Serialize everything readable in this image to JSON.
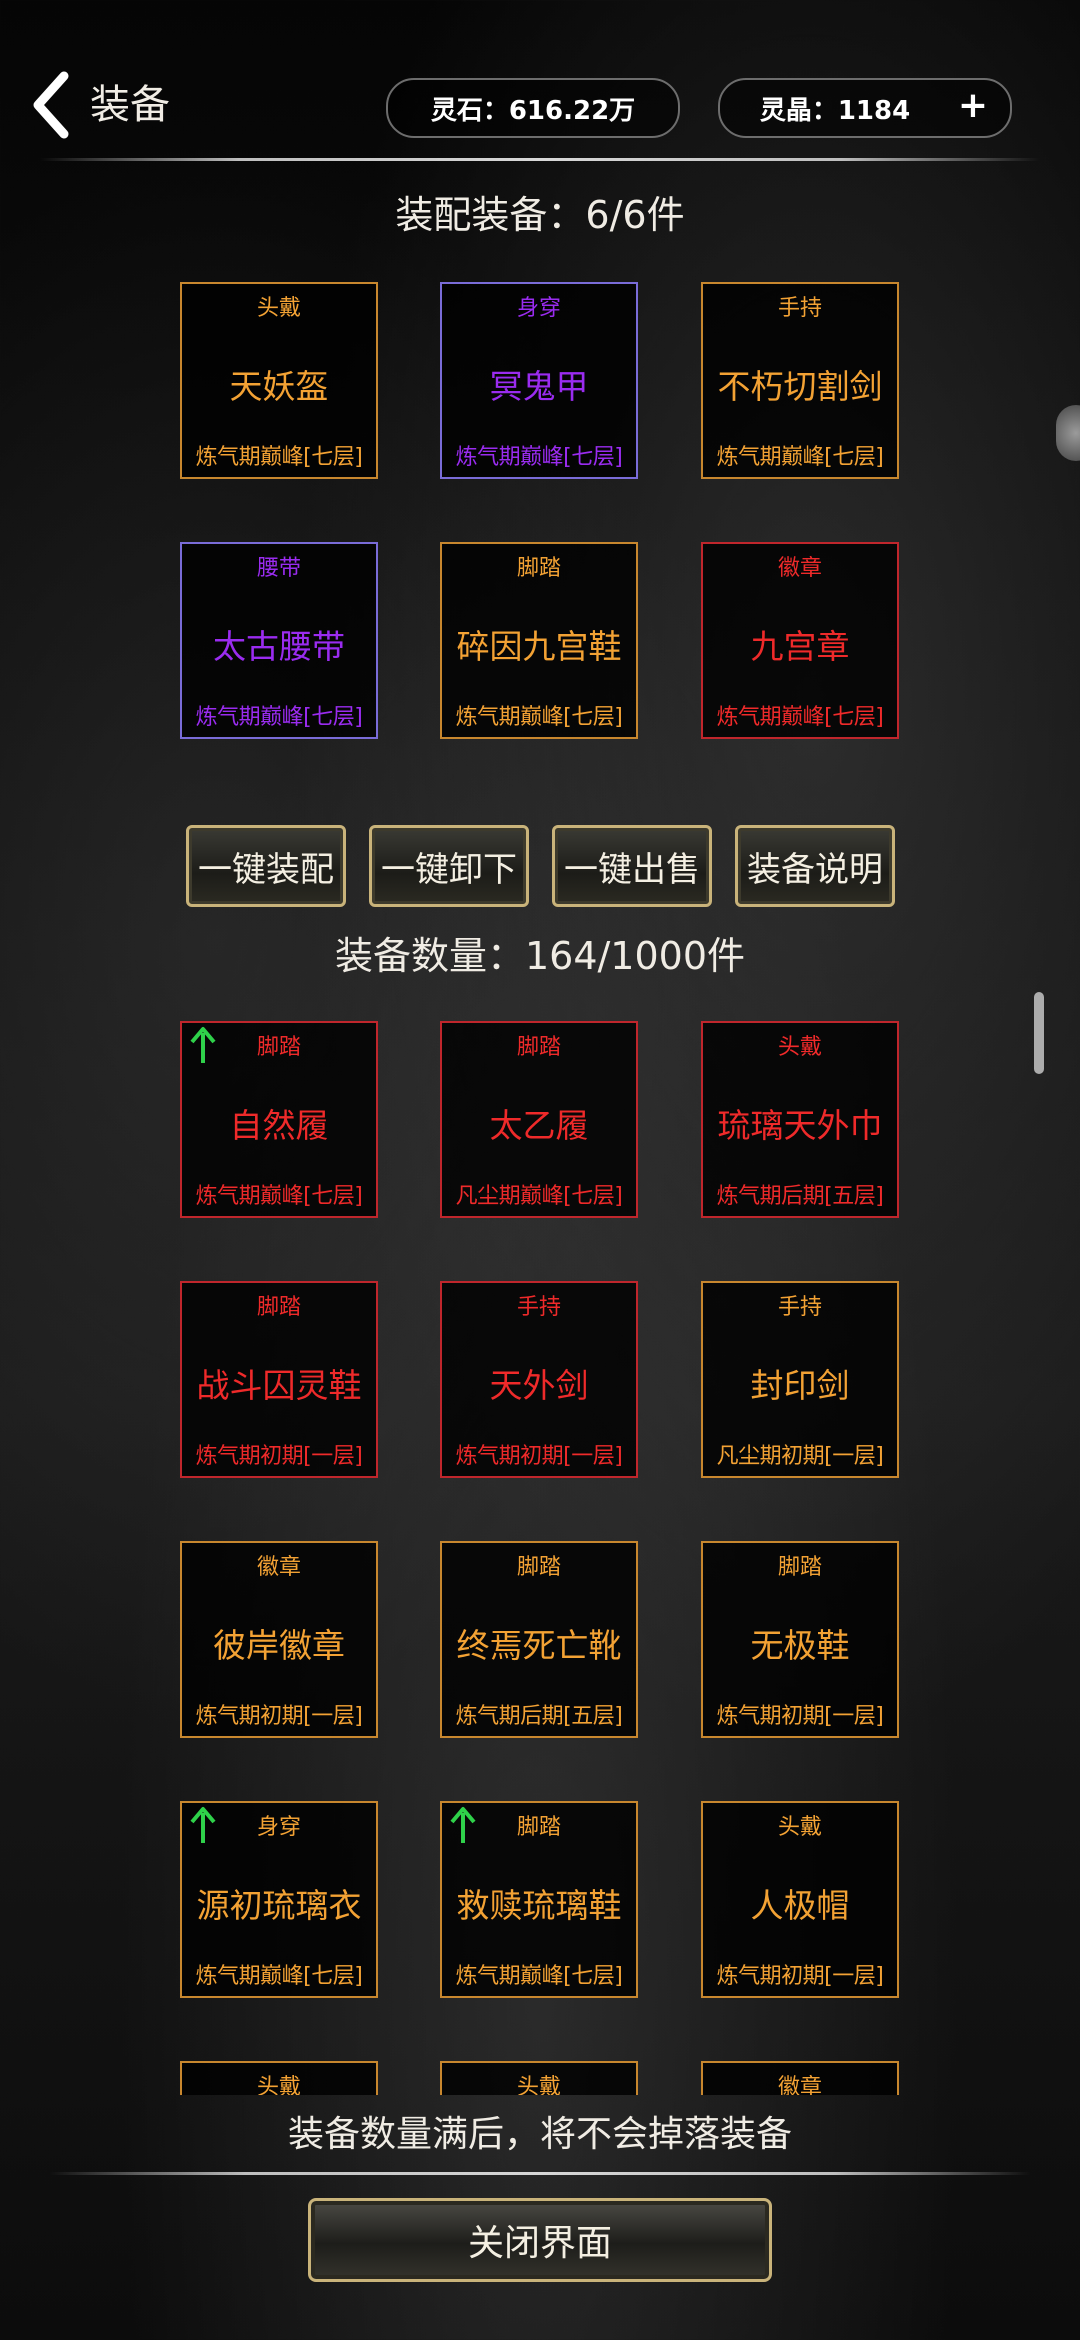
{
  "header": {
    "title": "装备",
    "spirit_stone": "灵石：616.22万",
    "spirit_crystal": "灵晶：1184"
  },
  "equipped": {
    "heading": "装配装备：6/6件",
    "items": [
      {
        "slot": "头戴",
        "name": "天妖盔",
        "level": "炼气期巅峰[七层]",
        "quality": "orange"
      },
      {
        "slot": "身穿",
        "name": "冥鬼甲",
        "level": "炼气期巅峰[七层]",
        "quality": "purple"
      },
      {
        "slot": "手持",
        "name": "不朽切割剑",
        "level": "炼气期巅峰[七层]",
        "quality": "orange"
      },
      {
        "slot": "腰带",
        "name": "太古腰带",
        "level": "炼气期巅峰[七层]",
        "quality": "purple"
      },
      {
        "slot": "脚踏",
        "name": "碎因九宫鞋",
        "level": "炼气期巅峰[七层]",
        "quality": "orange"
      },
      {
        "slot": "徽章",
        "name": "九宫章",
        "level": "炼气期巅峰[七层]",
        "quality": "red"
      }
    ]
  },
  "actions": {
    "equip_all": "一键装配",
    "unequip_all": "一键卸下",
    "sell_all": "一键出售",
    "help": "装备说明"
  },
  "inventory": {
    "heading": "装备数量：164/1000件",
    "items": [
      {
        "slot": "脚踏",
        "name": "自然履",
        "level": "炼气期巅峰[七层]",
        "quality": "red",
        "upgrade": true
      },
      {
        "slot": "脚踏",
        "name": "太乙履",
        "level": "凡尘期巅峰[七层]",
        "quality": "red",
        "upgrade": false
      },
      {
        "slot": "头戴",
        "name": "琉璃天外巾",
        "level": "炼气期后期[五层]",
        "quality": "red",
        "upgrade": false
      },
      {
        "slot": "脚踏",
        "name": "战斗囚灵鞋",
        "level": "炼气期初期[一层]",
        "quality": "red",
        "upgrade": false
      },
      {
        "slot": "手持",
        "name": "天外剑",
        "level": "炼气期初期[一层]",
        "quality": "red",
        "upgrade": false
      },
      {
        "slot": "手持",
        "name": "封印剑",
        "level": "凡尘期初期[一层]",
        "quality": "orange",
        "upgrade": false
      },
      {
        "slot": "徽章",
        "name": "彼岸徽章",
        "level": "炼气期初期[一层]",
        "quality": "orange",
        "upgrade": false
      },
      {
        "slot": "脚踏",
        "name": "终焉死亡靴",
        "level": "炼气期后期[五层]",
        "quality": "orange",
        "upgrade": false
      },
      {
        "slot": "脚踏",
        "name": "无极鞋",
        "level": "炼气期初期[一层]",
        "quality": "orange",
        "upgrade": false
      },
      {
        "slot": "身穿",
        "name": "源初琉璃衣",
        "level": "炼气期巅峰[七层]",
        "quality": "orange",
        "upgrade": true
      },
      {
        "slot": "脚踏",
        "name": "救赎琉璃鞋",
        "level": "炼气期巅峰[七层]",
        "quality": "orange",
        "upgrade": true
      },
      {
        "slot": "头戴",
        "name": "人极帽",
        "level": "炼气期初期[一层]",
        "quality": "orange",
        "upgrade": false
      },
      {
        "slot": "头戴",
        "name": "",
        "level": "",
        "quality": "orange",
        "upgrade": false
      },
      {
        "slot": "头戴",
        "name": "",
        "level": "",
        "quality": "orange",
        "upgrade": false
      },
      {
        "slot": "徽章",
        "name": "",
        "level": "",
        "quality": "orange",
        "upgrade": false
      }
    ]
  },
  "footer": {
    "note": "装备数量满后，将不会掉落装备",
    "close": "关闭界面"
  },
  "colors": {
    "orange": "#f3a234",
    "purple": "#9a2cf0",
    "red": "#ef2a2a",
    "upgrade_arrow": "#2fd14a"
  }
}
